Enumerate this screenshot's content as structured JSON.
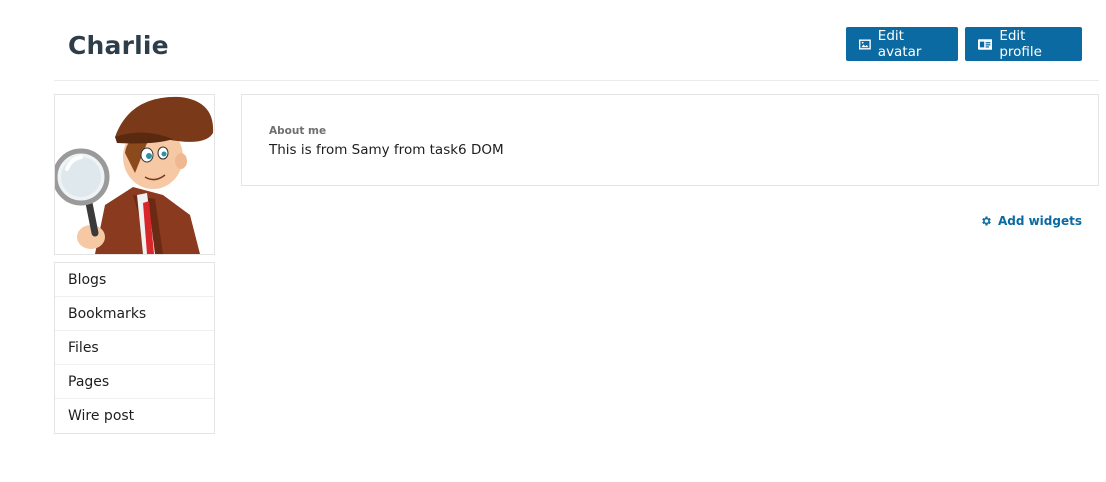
{
  "header": {
    "title": "Charlie",
    "edit_avatar_label": "Edit avatar",
    "edit_profile_label": "Edit profile",
    "edit_avatar_icon": "image-icon",
    "edit_profile_icon": "id-card-icon"
  },
  "owner_menu": {
    "items": [
      {
        "label": "Blogs"
      },
      {
        "label": "Bookmarks"
      },
      {
        "label": "Files"
      },
      {
        "label": "Pages"
      },
      {
        "label": "Wire post"
      }
    ]
  },
  "about": {
    "label": "About me",
    "text": "This is from Samy from task6 DOM"
  },
  "widgets": {
    "add_label": "Add widgets",
    "icon": "gear-icon"
  },
  "colors": {
    "accent": "#0b6aa1",
    "title": "#2d3e4a",
    "border": "#e4e4e4"
  }
}
